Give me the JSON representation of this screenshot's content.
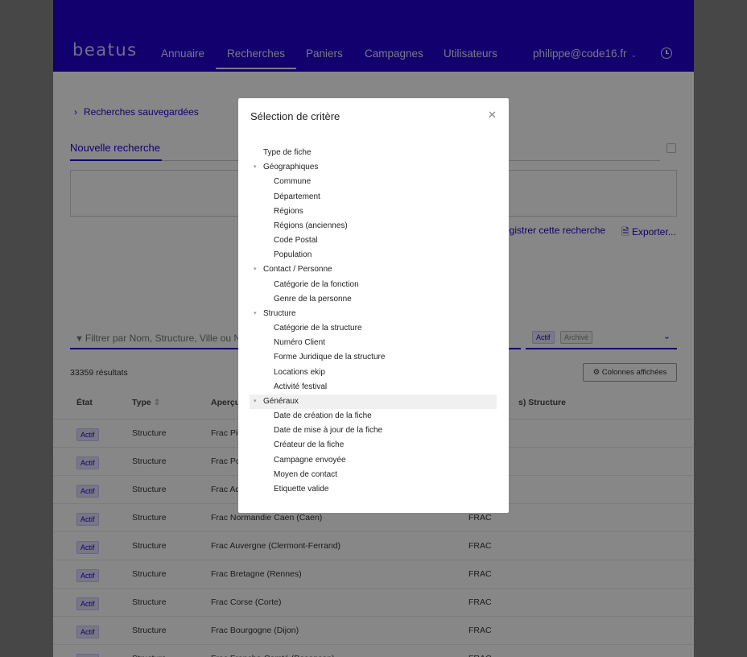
{
  "app": {
    "logo": "beatus",
    "nav": [
      "Annuaire",
      "Recherches",
      "Paniers",
      "Campagnes",
      "Utilisateurs"
    ],
    "active_nav": "Recherches",
    "user": "philippe@code16.fr",
    "user_chevron": "⌄"
  },
  "search": {
    "saved_searches_link": "Recherches sauvegardées",
    "new_search_tab": "Nouvelle recherche",
    "save_search": "egistrer cette recherche",
    "export": "Exporter...",
    "filter_placeholder": "Filtrer par Nom, Structure, Ville ou Nu",
    "status_chips": [
      "Actif",
      "Archivé"
    ],
    "results_count": "33359 résultats",
    "columns_button": "Colonnes affichées"
  },
  "table": {
    "headers": {
      "etat": "État",
      "type": "Type",
      "apercu": "Aperçu",
      "structure": "s) Structure"
    },
    "rows": [
      {
        "etat": "Actif",
        "type": "Structure",
        "apercu": "Frac Pic",
        "structure": ""
      },
      {
        "etat": "Actif",
        "type": "Structure",
        "apercu": "Frac Po",
        "structure": ""
      },
      {
        "etat": "Actif",
        "type": "Structure",
        "apercu": "Frac Aq",
        "structure": ""
      },
      {
        "etat": "Actif",
        "type": "Structure",
        "apercu": "Frac Normandie Caen (Caen)",
        "structure": "FRAC"
      },
      {
        "etat": "Actif",
        "type": "Structure",
        "apercu": "Frac Auvergne (Clermont-Ferrand)",
        "structure": "FRAC"
      },
      {
        "etat": "Actif",
        "type": "Structure",
        "apercu": "Frac Bretagne (Rennes)",
        "structure": "FRAC"
      },
      {
        "etat": "Actif",
        "type": "Structure",
        "apercu": "Frac Corse (Corte)",
        "structure": "FRAC"
      },
      {
        "etat": "Actif",
        "type": "Structure",
        "apercu": "Frac Bourgogne (Dijon)",
        "structure": "FRAC"
      },
      {
        "etat": "Actif",
        "type": "Structure",
        "apercu": "Frac Franche-Comté (Besançon)",
        "structure": "FRAC"
      }
    ]
  },
  "modal": {
    "title": "Sélection de critère",
    "tree": [
      {
        "label": "Type de fiche",
        "level": 0,
        "caret": false
      },
      {
        "label": "Géographiques",
        "level": 0,
        "caret": true
      },
      {
        "label": "Commune",
        "level": 1,
        "caret": false
      },
      {
        "label": "Département",
        "level": 1,
        "caret": false
      },
      {
        "label": "Régions",
        "level": 1,
        "caret": false
      },
      {
        "label": "Régions (anciennes)",
        "level": 1,
        "caret": false
      },
      {
        "label": "Code Postal",
        "level": 1,
        "caret": false
      },
      {
        "label": "Population",
        "level": 1,
        "caret": false
      },
      {
        "label": "Contact / Personne",
        "level": 0,
        "caret": true
      },
      {
        "label": "Catégorie de la fonction",
        "level": 1,
        "caret": false
      },
      {
        "label": "Genre de la personne",
        "level": 1,
        "caret": false
      },
      {
        "label": "Structure",
        "level": 0,
        "caret": true
      },
      {
        "label": "Catégorie de la structure",
        "level": 1,
        "caret": false
      },
      {
        "label": "Numéro Client",
        "level": 1,
        "caret": false
      },
      {
        "label": "Forme Juridique de la structure",
        "level": 1,
        "caret": false
      },
      {
        "label": "Locations ekip",
        "level": 1,
        "caret": false
      },
      {
        "label": "Activité festival",
        "level": 1,
        "caret": false
      },
      {
        "label": "Généraux",
        "level": 0,
        "caret": true,
        "highlighted": true
      },
      {
        "label": "Date de création de la fiche",
        "level": 1,
        "caret": false
      },
      {
        "label": "Date de mise à jour de la fiche",
        "level": 1,
        "caret": false
      },
      {
        "label": "Créateur de la fiche",
        "level": 1,
        "caret": false
      },
      {
        "label": "Campagne envoyée",
        "level": 1,
        "caret": false
      },
      {
        "label": "Moyen de contact",
        "level": 1,
        "caret": false
      },
      {
        "label": "Etiquette valide",
        "level": 1,
        "caret": false
      }
    ]
  }
}
